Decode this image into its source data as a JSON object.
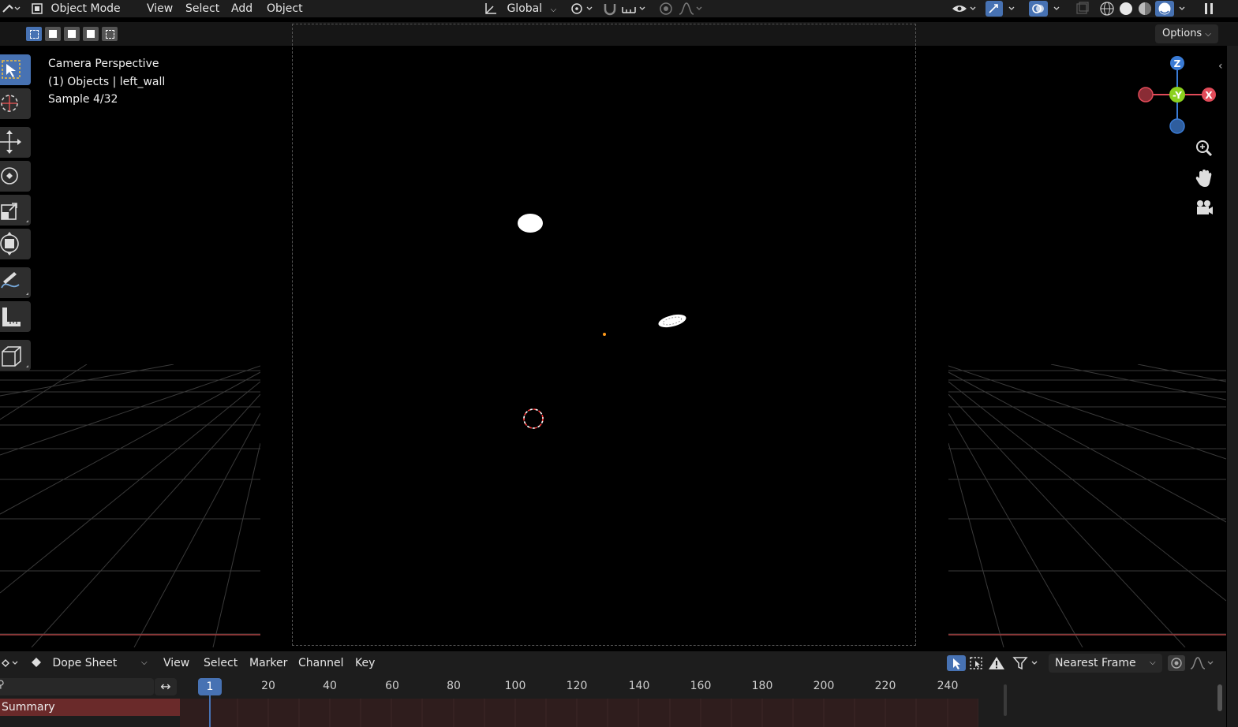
{
  "header": {
    "mode": "Object Mode",
    "menus": [
      "View",
      "Select",
      "Add",
      "Object"
    ],
    "transform_orientation": "Global"
  },
  "toolbar": {
    "options_label": "Options"
  },
  "viewport": {
    "info_lines": [
      "Camera Perspective",
      "(1) Objects | left_wall",
      "Sample 4/32"
    ]
  },
  "gizmo": {
    "z": "Z",
    "y": "-Y",
    "x": "X"
  },
  "dopesheet": {
    "editor": "Dope Sheet",
    "menus": [
      "View",
      "Select",
      "Marker",
      "Channel",
      "Key"
    ],
    "snap": "Nearest Frame",
    "current_frame": "1",
    "ticks": [
      "20",
      "40",
      "60",
      "80",
      "100",
      "120",
      "140",
      "160",
      "180",
      "200",
      "220",
      "240"
    ],
    "summary_label": "Summary"
  },
  "colors": {
    "accent": "#4772b3",
    "axis_x": "#e24b59",
    "axis_y": "#8bd11e",
    "axis_z": "#3a7bd5"
  }
}
